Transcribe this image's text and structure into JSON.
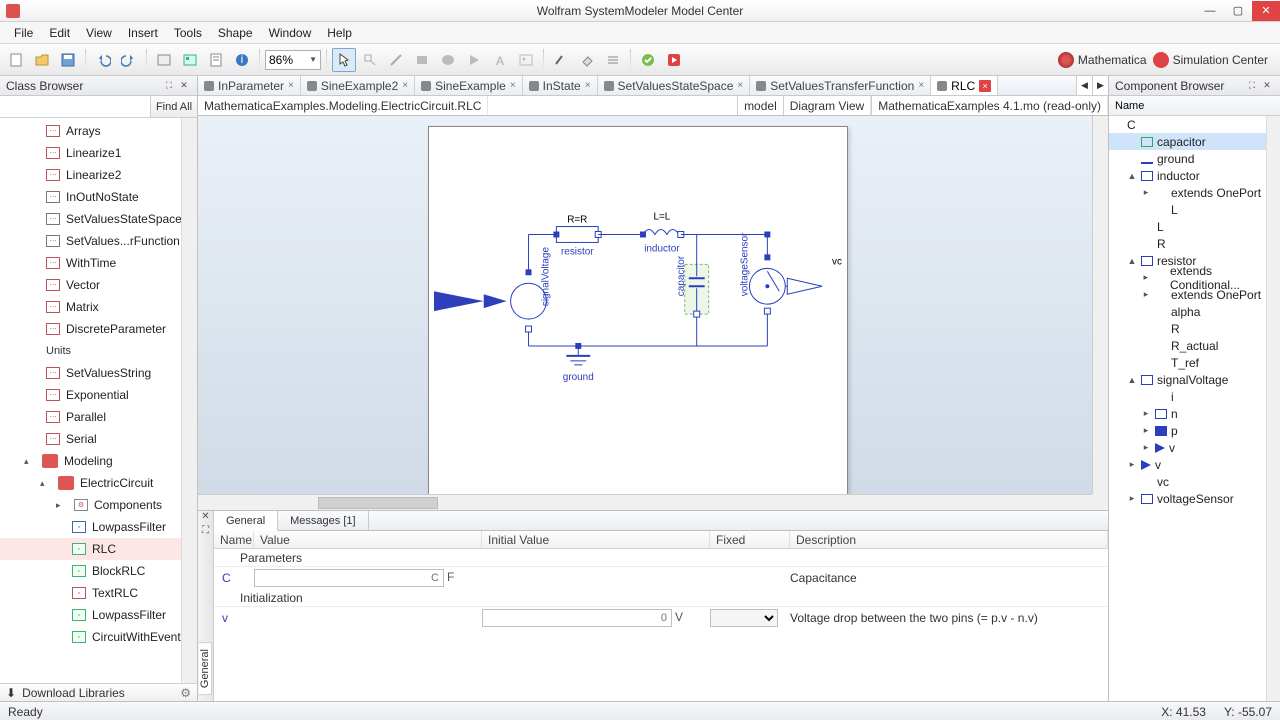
{
  "window": {
    "title": "Wolfram SystemModeler Model Center"
  },
  "menu": [
    "File",
    "Edit",
    "View",
    "Insert",
    "Tools",
    "Shape",
    "Window",
    "Help"
  ],
  "toolbar": {
    "zoom": "86%",
    "links": {
      "mathematica": "Mathematica",
      "simcenter": "Simulation Center"
    }
  },
  "leftPanel": {
    "title": "Class Browser",
    "findAll": "Find All",
    "items": [
      {
        "label": "Arrays",
        "ico": "txt",
        "depth": 0
      },
      {
        "label": "Linearize1",
        "ico": "txt",
        "depth": 0
      },
      {
        "label": "Linearize2",
        "ico": "txt",
        "depth": 0
      },
      {
        "label": "InOutNoState",
        "ico": "blk",
        "depth": 0
      },
      {
        "label": "SetValuesStateSpace",
        "ico": "blk",
        "depth": 0
      },
      {
        "label": "SetValues...rFunction",
        "ico": "blk",
        "depth": 0
      },
      {
        "label": "WithTime",
        "ico": "txt",
        "depth": 0
      },
      {
        "label": "Vector",
        "ico": "txt",
        "depth": 0
      },
      {
        "label": "Matrix",
        "ico": "txt",
        "depth": 0
      },
      {
        "label": "DiscreteParameter",
        "ico": "txt",
        "depth": 0
      }
    ],
    "unitsLabel": "Units",
    "unitsItems": [
      {
        "label": "SetValuesString",
        "ico": "txt"
      },
      {
        "label": "Exponential",
        "ico": "txt"
      },
      {
        "label": "Parallel",
        "ico": "txt"
      },
      {
        "label": "Serial",
        "ico": "txt"
      }
    ],
    "modeling": {
      "label": "Modeling",
      "electric": "ElectricCircuit",
      "components": "Components",
      "children": [
        {
          "label": "LowpassFilter",
          "ico": "blue"
        },
        {
          "label": "RLC",
          "ico": "green",
          "selected": true
        },
        {
          "label": "BlockRLC",
          "ico": "green"
        },
        {
          "label": "TextRLC",
          "ico": "txt"
        },
        {
          "label": "LowpassFilter",
          "ico": "green"
        },
        {
          "label": "CircuitWithEvent",
          "ico": "green"
        }
      ]
    },
    "download": "Download Libraries"
  },
  "tabs": [
    {
      "label": "InParameter"
    },
    {
      "label": "SineExample2"
    },
    {
      "label": "SineExample"
    },
    {
      "label": "InState"
    },
    {
      "label": "SetValuesStateSpace"
    },
    {
      "label": "SetValuesTransferFunction"
    },
    {
      "label": "RLC",
      "active": true
    }
  ],
  "path": {
    "crumb": "MathematicaExamples.Modeling.ElectricCircuit.RLC",
    "model": "model",
    "view": "Diagram View",
    "file": "MathematicaExamples 4.1.mo (read-only)"
  },
  "diagram": {
    "resistor_top": "R=R",
    "resistor": "resistor",
    "inductor_top": "L=L",
    "inductor": "inductor",
    "ground": "ground",
    "vc": "vc",
    "sigv": "signalVoltage",
    "cap": "capacitor",
    "vs": "voltageSensor"
  },
  "rightPanel": {
    "title": "Component Browser",
    "nameCol": "Name",
    "root": "C",
    "items": [
      {
        "label": "capacitor",
        "d": 1,
        "ico": "cap",
        "exp": "",
        "sel": true
      },
      {
        "label": "ground",
        "d": 1,
        "ico": "gnd",
        "exp": ""
      },
      {
        "label": "inductor",
        "d": 1,
        "ico": "res",
        "exp": "▲"
      },
      {
        "label": "extends OnePort",
        "d": 2,
        "ico": "",
        "exp": "▸"
      },
      {
        "label": "L",
        "d": 2,
        "ico": "",
        "exp": ""
      },
      {
        "label": "L",
        "d": 1,
        "ico": "",
        "exp": ""
      },
      {
        "label": "R",
        "d": 1,
        "ico": "",
        "exp": ""
      },
      {
        "label": "resistor",
        "d": 1,
        "ico": "res",
        "exp": "▲"
      },
      {
        "label": "extends Conditional...",
        "d": 2,
        "ico": "",
        "exp": "▸"
      },
      {
        "label": "extends OnePort",
        "d": 2,
        "ico": "",
        "exp": "▸"
      },
      {
        "label": "alpha",
        "d": 2,
        "ico": "",
        "exp": ""
      },
      {
        "label": "R",
        "d": 2,
        "ico": "",
        "exp": ""
      },
      {
        "label": "R_actual",
        "d": 2,
        "ico": "",
        "exp": ""
      },
      {
        "label": "T_ref",
        "d": 2,
        "ico": "",
        "exp": ""
      },
      {
        "label": "signalVoltage",
        "d": 1,
        "ico": "res",
        "exp": "▲"
      },
      {
        "label": "i",
        "d": 2,
        "ico": "",
        "exp": ""
      },
      {
        "label": "n",
        "d": 2,
        "ico": "port-w",
        "exp": "▸"
      },
      {
        "label": "p",
        "d": 2,
        "ico": "port-b",
        "exp": "▸"
      },
      {
        "label": "v",
        "d": 2,
        "ico": "tri",
        "exp": "▸"
      },
      {
        "label": "v",
        "d": 1,
        "ico": "tri",
        "exp": "▸"
      },
      {
        "label": "vc",
        "d": 1,
        "ico": "",
        "exp": ""
      },
      {
        "label": "voltageSensor",
        "d": 1,
        "ico": "res",
        "exp": "▸"
      }
    ]
  },
  "props": {
    "tabs": {
      "general": "General",
      "messages": "Messages [1]"
    },
    "cols": {
      "name": "Name",
      "value": "Value",
      "init": "Initial Value",
      "fixed": "Fixed",
      "desc": "Description"
    },
    "sectParams": "Parameters",
    "sectInit": "Initialization",
    "rows": {
      "c": {
        "name": "C",
        "valuePH": "C",
        "unit": "F",
        "desc": "Capacitance"
      },
      "v": {
        "name": "v",
        "initPH": "0",
        "unit": "V",
        "desc": "Voltage drop between the two pins (= p.v - n.v)"
      }
    },
    "gutterTab": "General"
  },
  "status": {
    "ready": "Ready",
    "x": "X: 41.53",
    "y": "Y: -55.07"
  }
}
